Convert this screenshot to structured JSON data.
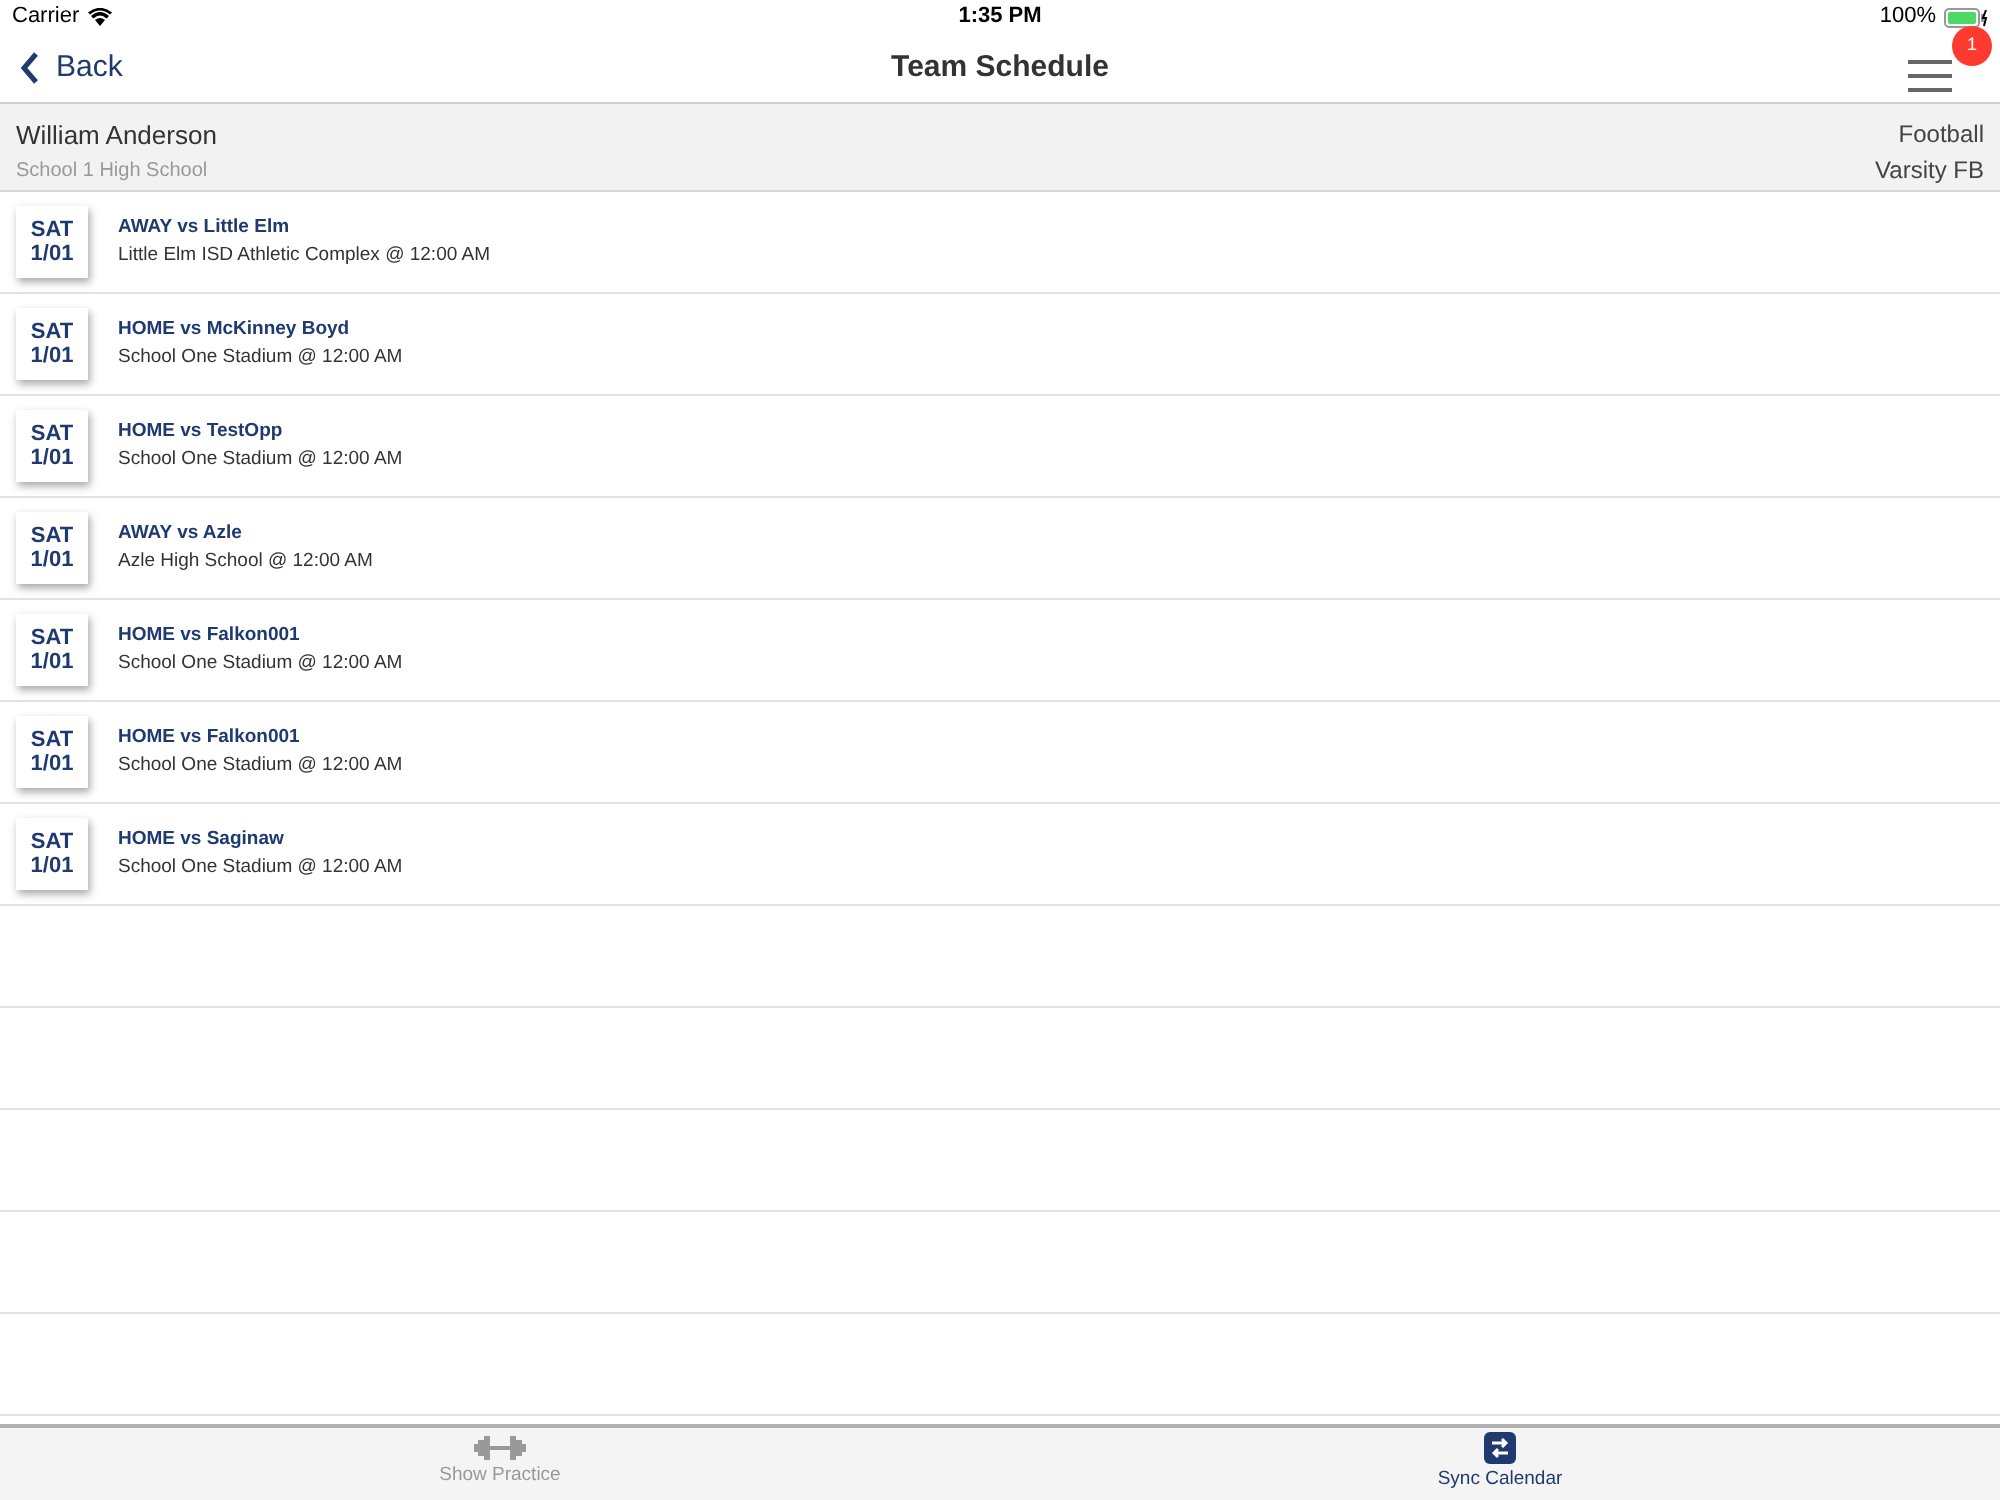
{
  "status_bar": {
    "carrier": "Carrier",
    "time": "1:35 PM",
    "battery": "100%"
  },
  "nav": {
    "back": "Back",
    "title": "Team Schedule",
    "badge": "1"
  },
  "profile": {
    "name": "William Anderson",
    "school": "School 1 High School",
    "sport": "Football",
    "team": "Varsity FB"
  },
  "games": [
    {
      "day": "SAT",
      "date": "1/01",
      "title": "AWAY vs Little Elm",
      "location": "Little Elm ISD Athletic Complex @ 12:00 AM"
    },
    {
      "day": "SAT",
      "date": "1/01",
      "title": "HOME vs McKinney Boyd",
      "location": "School One Stadium @ 12:00 AM"
    },
    {
      "day": "SAT",
      "date": "1/01",
      "title": "HOME vs TestOpp",
      "location": "School One Stadium @ 12:00 AM"
    },
    {
      "day": "SAT",
      "date": "1/01",
      "title": "AWAY vs Azle",
      "location": "Azle High School @ 12:00 AM"
    },
    {
      "day": "SAT",
      "date": "1/01",
      "title": "HOME vs Falkon001",
      "location": "School One Stadium @ 12:00 AM"
    },
    {
      "day": "SAT",
      "date": "1/01",
      "title": "HOME vs Falkon001",
      "location": "School One Stadium @ 12:00 AM"
    },
    {
      "day": "SAT",
      "date": "1/01",
      "title": "HOME vs Saginaw",
      "location": "School One Stadium @ 12:00 AM"
    }
  ],
  "tabs": [
    {
      "kind": "practice",
      "label": "Show Practice",
      "selected": false
    },
    {
      "kind": "sync",
      "label": "Sync Calendar",
      "selected": true
    }
  ]
}
